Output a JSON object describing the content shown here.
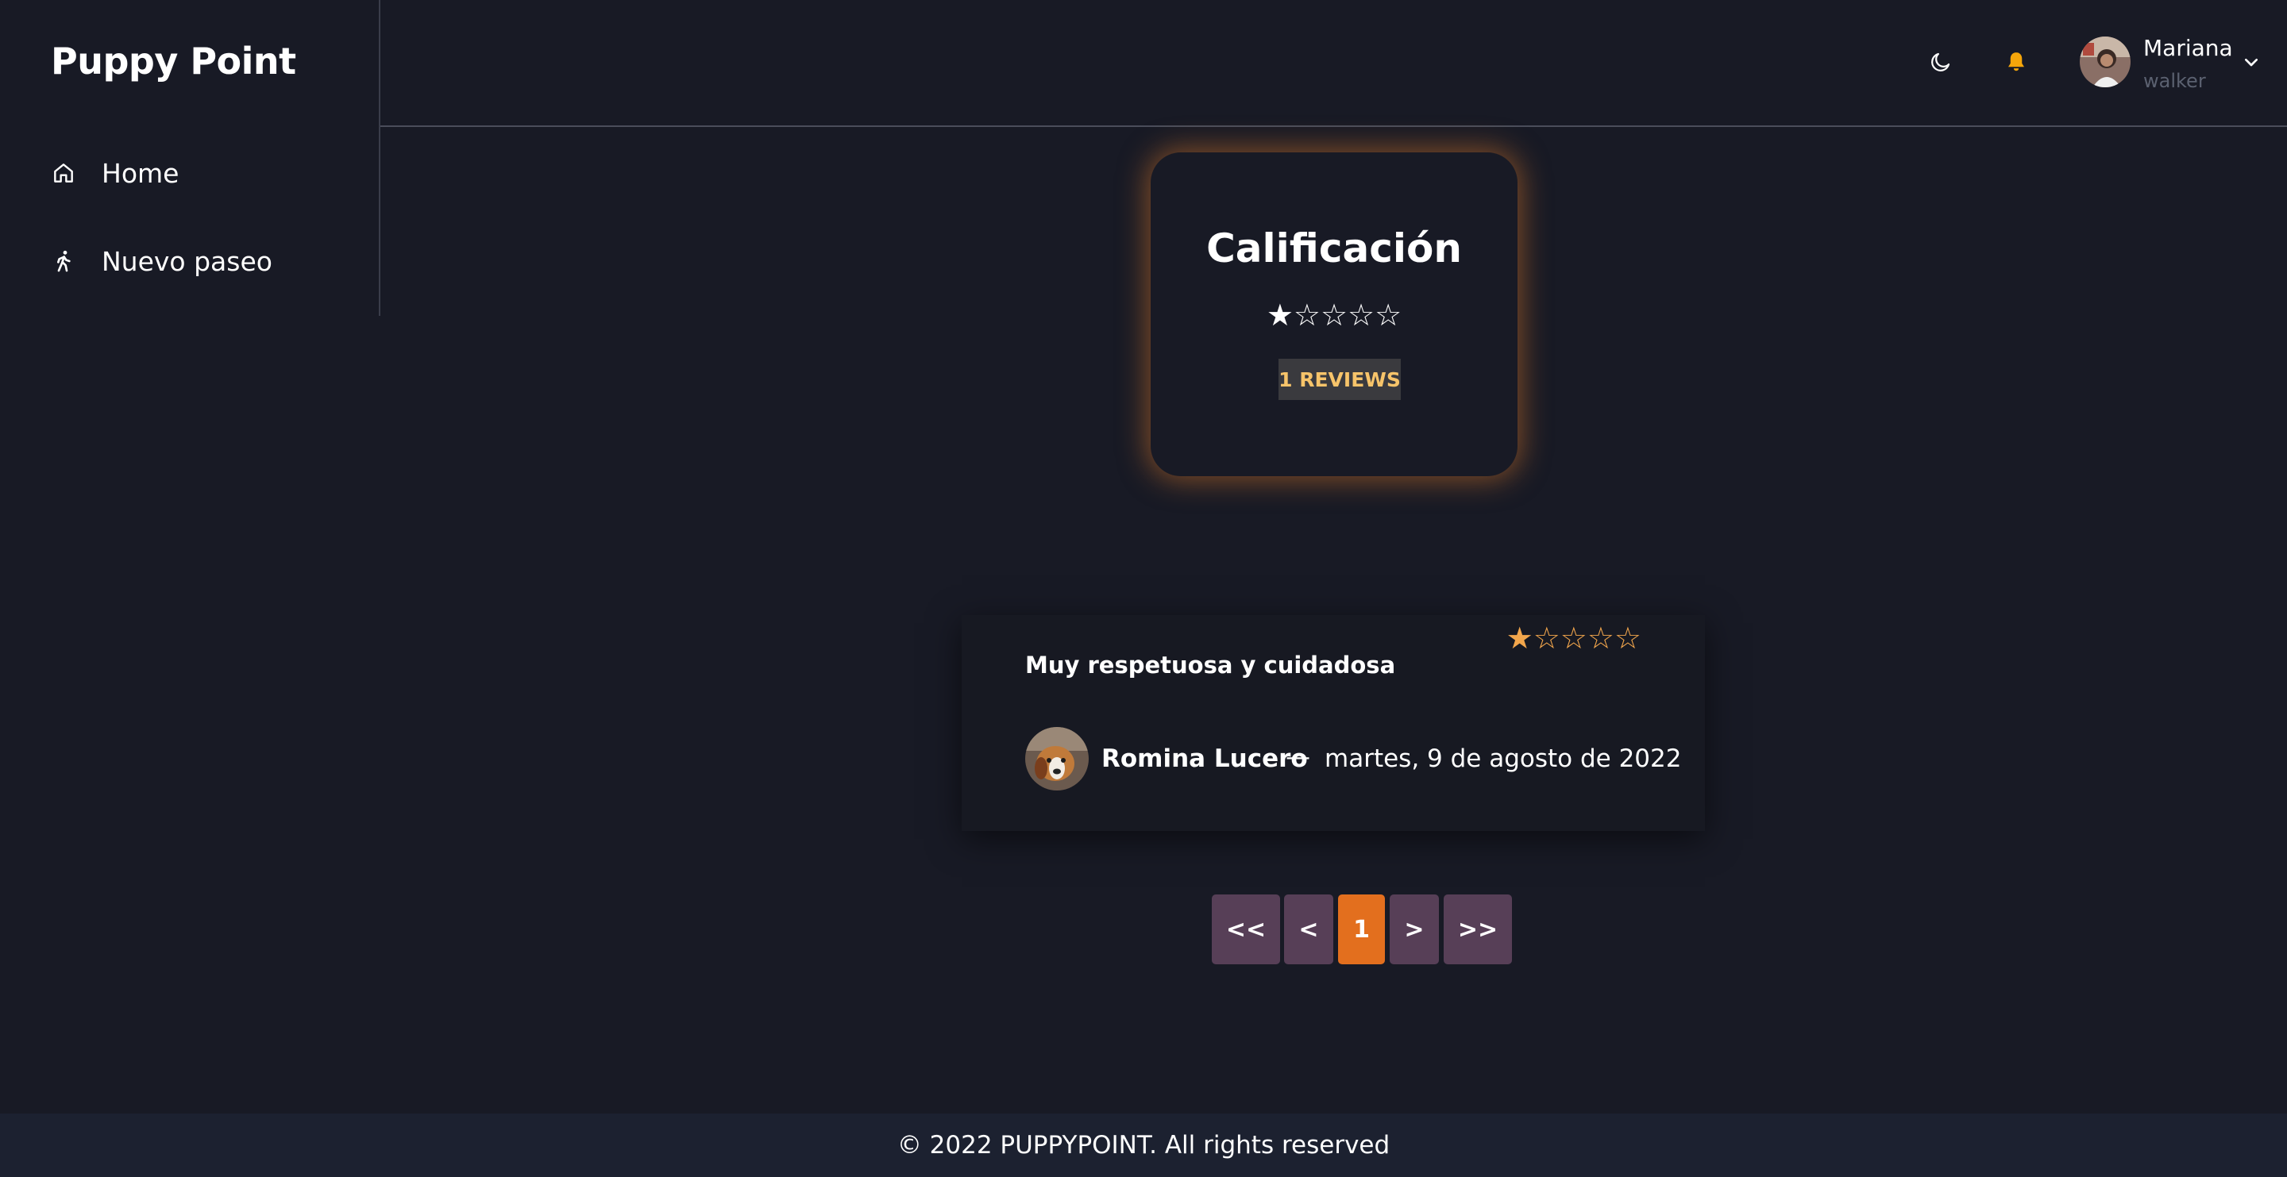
{
  "brand": "Puppy Point",
  "sidebar": {
    "items": [
      {
        "label": "Home",
        "icon": "home-icon"
      },
      {
        "label": "Nuevo paseo",
        "icon": "walking-icon"
      }
    ]
  },
  "header": {
    "theme_icon": "moon-icon",
    "notification_icon": "bell-icon",
    "user": {
      "name": "Mariana",
      "role": "walker",
      "chevron_icon": "chevron-down-icon"
    }
  },
  "rating_card": {
    "title": "Calificación",
    "rating": 1,
    "max_rating": 5,
    "stars": "★☆☆☆☆",
    "reviews_label": "1 REVIEWS"
  },
  "reviews": [
    {
      "text": "Muy respetuosa y cuidadosa",
      "rating": 1,
      "stars": "★☆☆☆☆",
      "author": "Romina Lucero",
      "separator": "—",
      "date": "martes, 9 de agosto de 2022"
    }
  ],
  "pagination": {
    "first": "<<",
    "prev": "<",
    "current": "1",
    "next": ">",
    "last": ">>"
  },
  "footer": {
    "text": "© 2022 PUPPYPOINT. All rights reserved"
  },
  "colors": {
    "background": "#181a25",
    "accent": "#e36f1e",
    "pager": "#573f57",
    "star_review": "#f2a64c",
    "badge_text": "#f7c46a",
    "bell": "#f5a60a"
  }
}
